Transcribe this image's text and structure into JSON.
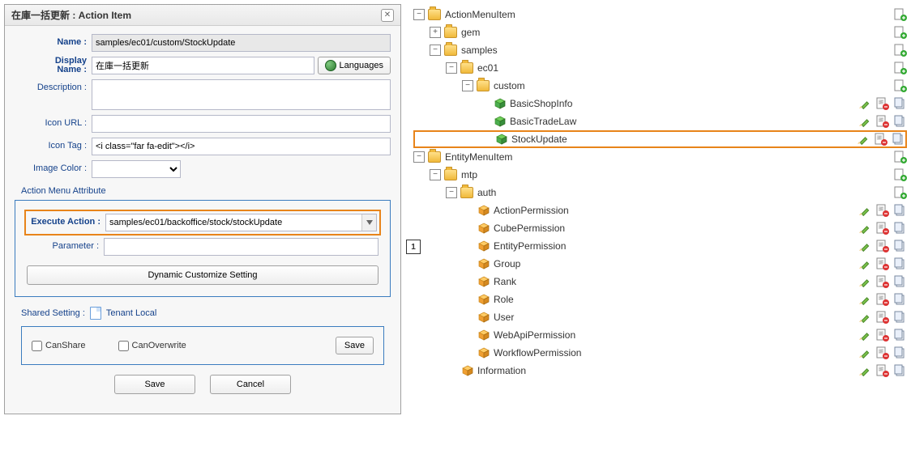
{
  "dialog": {
    "title": "在庫一括更新 : Action Item",
    "fields": {
      "name_label": "Name :",
      "name_value": "samples/ec01/custom/StockUpdate",
      "display_name_label": "Display Name :",
      "display_name_value": "在庫一括更新",
      "languages_btn": "Languages",
      "description_label": "Description :",
      "description_value": "",
      "icon_url_label": "Icon URL :",
      "icon_url_value": "",
      "icon_tag_label": "Icon Tag :",
      "icon_tag_value": "<i class=\"far fa-edit\"></i>",
      "image_color_label": "Image Color :",
      "image_color_value": ""
    },
    "attribute": {
      "section_label": "Action Menu Attribute",
      "execute_action_label": "Execute Action :",
      "execute_action_value": "samples/ec01/backoffice/stock/stockUpdate",
      "parameter_label": "Parameter :",
      "parameter_value": "",
      "dynamic_btn": "Dynamic Customize Setting"
    },
    "shared": {
      "label": "Shared Setting :",
      "scope": "Tenant Local",
      "can_share": "CanShare",
      "can_overwrite": "CanOverwrite",
      "save_small": "Save"
    },
    "footer": {
      "save": "Save",
      "cancel": "Cancel"
    }
  },
  "callout1": "1",
  "tree": {
    "root1": "ActionMenuItem",
    "gem": "gem",
    "samples": "samples",
    "ec01": "ec01",
    "custom": "custom",
    "basicShop": "BasicShopInfo",
    "basicTrade": "BasicTradeLaw",
    "stockUpdate": "StockUpdate",
    "root2": "EntityMenuItem",
    "mtp": "mtp",
    "auth": "auth",
    "actionPerm": "ActionPermission",
    "cubePerm": "CubePermission",
    "entityPerm": "EntityPermission",
    "group": "Group",
    "rank": "Rank",
    "role": "Role",
    "user": "User",
    "webApiPerm": "WebApiPermission",
    "workflowPerm": "WorkflowPermission",
    "information": "Information"
  }
}
